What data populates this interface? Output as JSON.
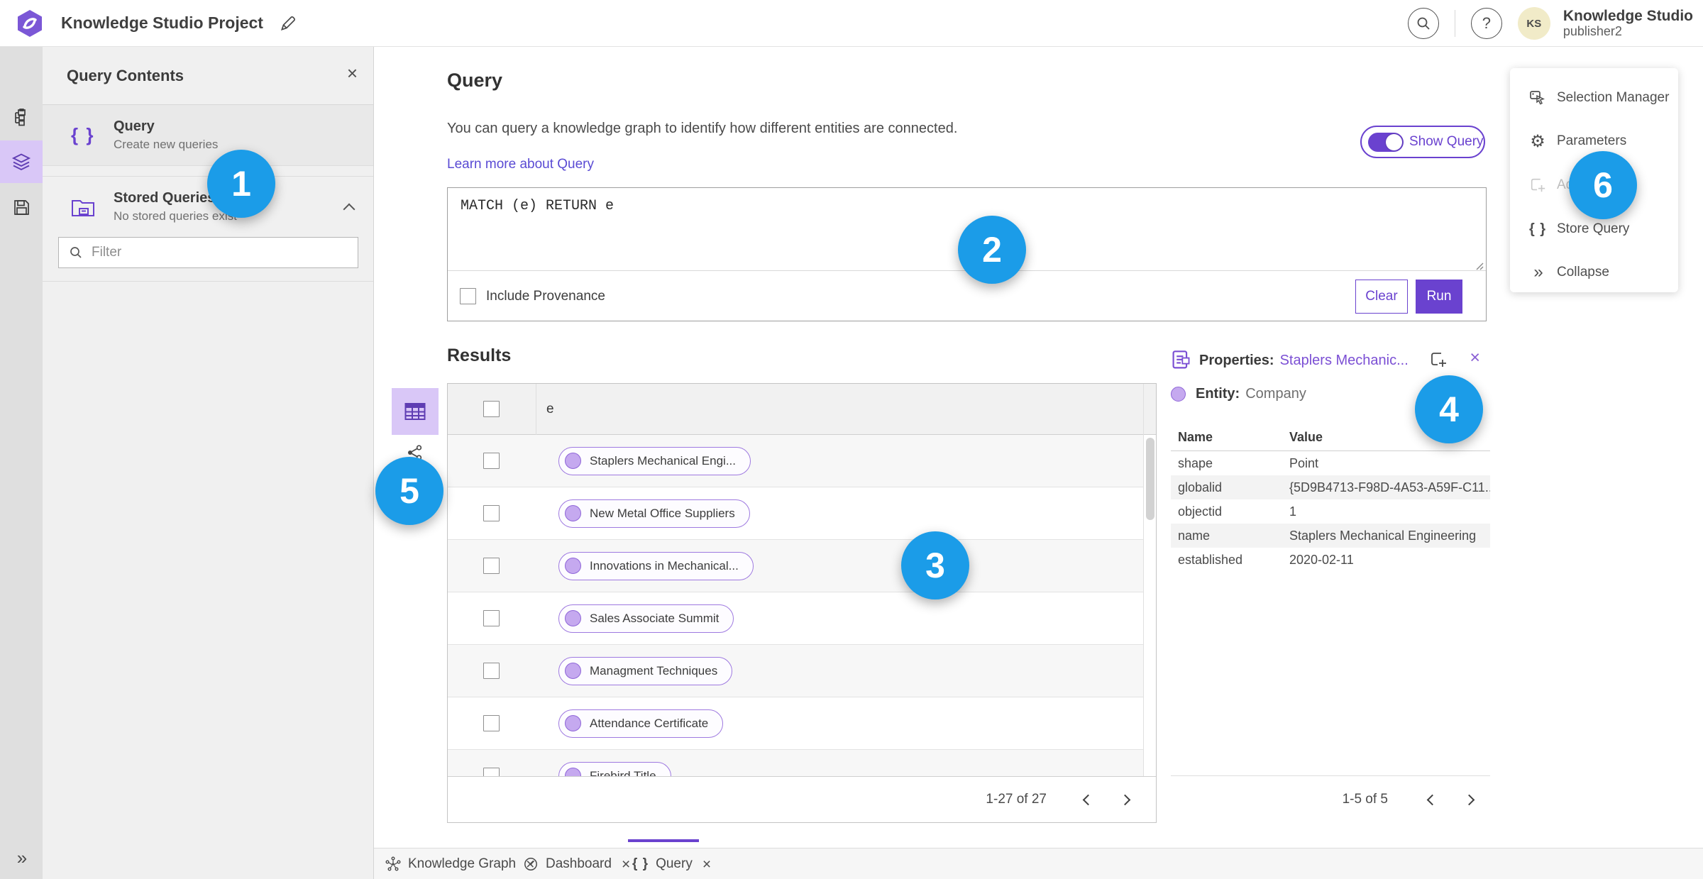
{
  "topbar": {
    "title": "Knowledge Studio Project",
    "user_initials": "KS",
    "user_name": "Knowledge Studio",
    "user_role": "publisher2",
    "help_glyph": "?"
  },
  "icons": {
    "close": "×",
    "braces": "{ }",
    "collapse_double_arrow": "»"
  },
  "contents_panel": {
    "title": "Query Contents",
    "query_item": {
      "title": "Query",
      "subtitle": "Create new queries"
    },
    "stored_item": {
      "title": "Stored Queries",
      "subtitle": "No stored queries exist"
    },
    "filter_placeholder": "Filter"
  },
  "query_panel": {
    "title": "Query",
    "description": "You can query a knowledge graph to identify how different entities are connected.",
    "learn_more": "Learn more about Query",
    "show_query_label": "Show Query",
    "query_text": "MATCH (e) RETURN e",
    "include_provenance_label": "Include Provenance",
    "clear_label": "Clear",
    "run_label": "Run"
  },
  "results": {
    "title": "Results",
    "column_header": "e",
    "rows": [
      {
        "label": "Staplers Mechanical Engi..."
      },
      {
        "label": "New Metal Office Suppliers"
      },
      {
        "label": "Innovations in Mechanical..."
      },
      {
        "label": "Sales Associate Summit"
      },
      {
        "label": "Managment Techniques"
      },
      {
        "label": "Attendance Certificate"
      },
      {
        "label": "Firebird Title"
      }
    ],
    "pagination_range": "1-27 of 27"
  },
  "properties_panel": {
    "label": "Properties:",
    "selected_link": "Staplers Mechanic...",
    "entity_label": "Entity:",
    "entity_value": "Company",
    "col_name": "Name",
    "col_value": "Value",
    "rows": [
      {
        "name": "shape",
        "value": "Point"
      },
      {
        "name": "globalid",
        "value": "{5D9B4713-F98D-4A53-A59F-C11..."
      },
      {
        "name": "objectid",
        "value": "1"
      },
      {
        "name": "name",
        "value": "Staplers Mechanical Engineering"
      },
      {
        "name": "established",
        "value": "2020-02-11"
      }
    ],
    "pagination_range": "1-5 of 5"
  },
  "right_menu": {
    "items": [
      {
        "label": "Selection Manager"
      },
      {
        "label": "Parameters"
      },
      {
        "label": "Add"
      },
      {
        "label": "Store Query"
      },
      {
        "label": "Collapse"
      }
    ]
  },
  "bottom_tabs": [
    {
      "label": "Knowledge Graph"
    },
    {
      "label": "Dashboard"
    },
    {
      "label": "Query"
    }
  ],
  "annotations": [
    "1",
    "2",
    "3",
    "4",
    "5",
    "6"
  ],
  "colors": {
    "accent_purple": "#6a42cf",
    "light_purple": "#d9c7f7",
    "badge_blue": "#1b9ce8",
    "chip_border": "#9e79e0",
    "chip_fill": "#c5a9ef"
  }
}
